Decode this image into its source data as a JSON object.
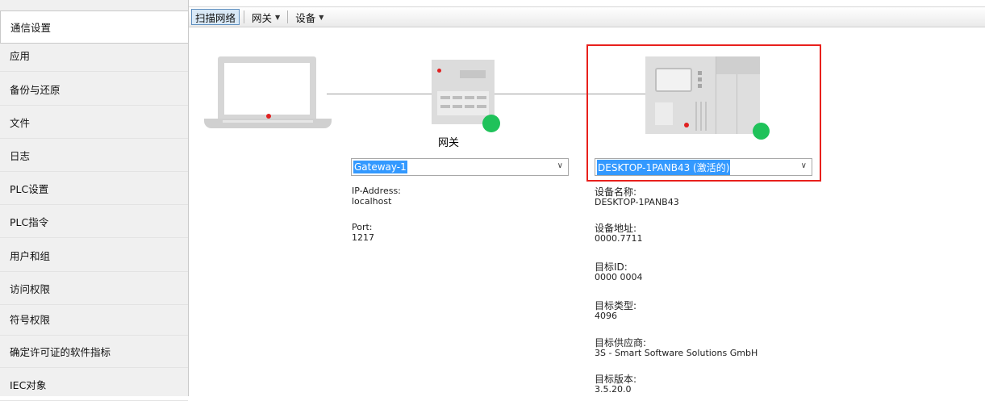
{
  "sidebar": {
    "items": [
      {
        "label": "通信设置",
        "selected": true
      },
      {
        "label": "应用"
      },
      {
        "label": "备份与还原"
      },
      {
        "label": "文件"
      },
      {
        "label": "日志"
      },
      {
        "label": "PLC设置"
      },
      {
        "label": "PLC指令"
      },
      {
        "label": "用户和组"
      },
      {
        "label": "访问权限"
      },
      {
        "label": "符号权限"
      },
      {
        "label": "确定许可证的软件指标"
      },
      {
        "label": "IEC对象"
      }
    ]
  },
  "toolbar": {
    "scan_label": "扫描网络",
    "gateway_label": "网关",
    "device_label": "设备"
  },
  "gateway": {
    "title": "网关",
    "combo_value": "Gateway-1",
    "ip_key": "IP-Address:",
    "ip_value": "localhost",
    "port_key": "Port:",
    "port_value": "1217"
  },
  "device": {
    "combo_value": "DESKTOP-1PANB43 (激活的)",
    "fields": [
      {
        "key": "设备名称:",
        "value": "DESKTOP-1PANB43"
      },
      {
        "key": "设备地址:",
        "value": "0000.7711"
      },
      {
        "key": "目标ID:",
        "value": "0000  0004"
      },
      {
        "key": "目标类型:",
        "value": "4096"
      },
      {
        "key": "目标供应商:",
        "value": "3S - Smart Software Solutions GmbH"
      },
      {
        "key": "目标版本:",
        "value": "3.5.20.0"
      }
    ]
  },
  "colors": {
    "status_online": "#1fc25a",
    "highlight_border": "#e8201c",
    "selection_blue": "#3399ff"
  }
}
